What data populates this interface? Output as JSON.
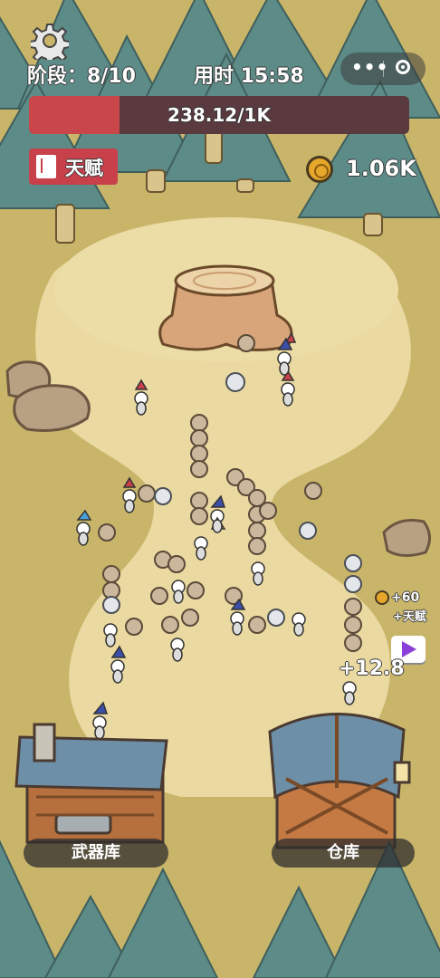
{
  "hud": {
    "stage": "阶段：8/10",
    "timer": "用时 15:58",
    "capsule_dots": "•••",
    "hp_text": "238.12/1K",
    "hp_fraction": 0.238,
    "talent_label": "天赋",
    "coins": "1.06K"
  },
  "rewards": {
    "coins": "+60",
    "talent": "+天赋"
  },
  "float_text": "+12.8",
  "buildings": {
    "armory": "武器库",
    "warehouse": "仓库"
  },
  "colors": {
    "hp_fill": "#c9474a",
    "hp_bg": "#5a3a3e",
    "talent_bg": "#c8404a",
    "ground": "#c9b56a",
    "path": "#ead9a0",
    "pine": "#5d8c88"
  },
  "icons": [
    "gear-icon",
    "more-dots-icon",
    "close-circle-icon",
    "book-icon",
    "coin-icon",
    "video-play-icon"
  ]
}
